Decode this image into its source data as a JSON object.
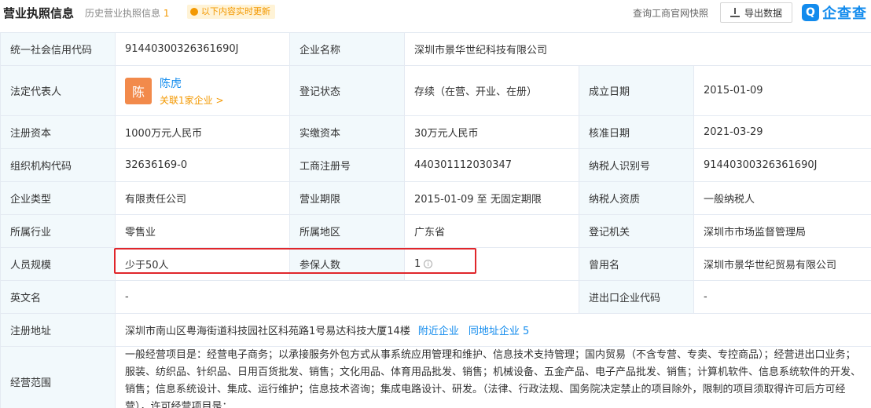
{
  "header": {
    "title": "营业执照信息",
    "history_label": "历史营业执照信息",
    "history_count": "1",
    "badge": "以下内容实时更新",
    "right_link": "查询工商官网快照",
    "export_label": "导出数据",
    "logo_text": "企查查"
  },
  "rows": {
    "credit_code": {
      "label": "统一社会信用代码",
      "value": "91440300326361690J"
    },
    "company_name": {
      "label": "企业名称",
      "value": "深圳市景华世纪科技有限公司"
    },
    "legal_rep": {
      "label": "法定代表人",
      "avatar": "陈",
      "name": "陈虎",
      "link": "关联1家企业 >"
    },
    "reg_status": {
      "label": "登记状态",
      "value": "存续（在营、开业、在册）"
    },
    "found_date": {
      "label": "成立日期",
      "value": "2015-01-09"
    },
    "reg_capital": {
      "label": "注册资本",
      "value": "1000万元人民币"
    },
    "paid_capital": {
      "label": "实缴资本",
      "value": "30万元人民币"
    },
    "approve_date": {
      "label": "核准日期",
      "value": "2021-03-29"
    },
    "org_code": {
      "label": "组织机构代码",
      "value": "32636169-0"
    },
    "biz_reg_no": {
      "label": "工商注册号",
      "value": "440301112030347"
    },
    "tax_id": {
      "label": "纳税人识别号",
      "value": "91440300326361690J"
    },
    "company_type": {
      "label": "企业类型",
      "value": "有限责任公司"
    },
    "biz_term": {
      "label": "营业期限",
      "value": "2015-01-09 至 无固定期限"
    },
    "taxpayer_qual": {
      "label": "纳税人资质",
      "value": "一般纳税人"
    },
    "industry": {
      "label": "所属行业",
      "value": "零售业"
    },
    "region": {
      "label": "所属地区",
      "value": "广东省"
    },
    "reg_authority": {
      "label": "登记机关",
      "value": "深圳市市场监督管理局"
    },
    "staff_size": {
      "label": "人员规模",
      "value": "少于50人"
    },
    "insured": {
      "label": "参保人数",
      "value": "1"
    },
    "former_name": {
      "label": "曾用名",
      "value": "深圳市景华世纪贸易有限公司"
    },
    "english_name": {
      "label": "英文名",
      "value": "-"
    },
    "import_export_code": {
      "label": "进出口企业代码",
      "value": "-"
    },
    "address": {
      "label": "注册地址",
      "value": "深圳市南山区粤海街道科技园社区科苑路1号易达科技大厦14楼",
      "link1": "附近企业",
      "link2": "同地址企业 5"
    },
    "scope": {
      "label": "经营范围",
      "value": "一般经营项目是：经营电子商务；以承接服务外包方式从事系统应用管理和维护、信息技术支持管理；国内贸易（不含专营、专卖、专控商品）；经营进出口业务；服装、纺织品、针织品、日用百货批发、销售；文化用品、体育用品批发、销售；机械设备、五金产品、电子产品批发、销售；计算机软件、信息系统软件的开发、销售；信息系统设计、集成、运行维护；信息技术咨询；集成电路设计、研发。（法律、行政法规、国务院决定禁止的项目除外，限制的项目须取得许可后方可经营），许可经营项目是："
    }
  },
  "colors": {
    "accent": "#128bed",
    "label_bg": "#f2f9fc",
    "highlight": "#e0262b",
    "orange": "#f39800"
  }
}
